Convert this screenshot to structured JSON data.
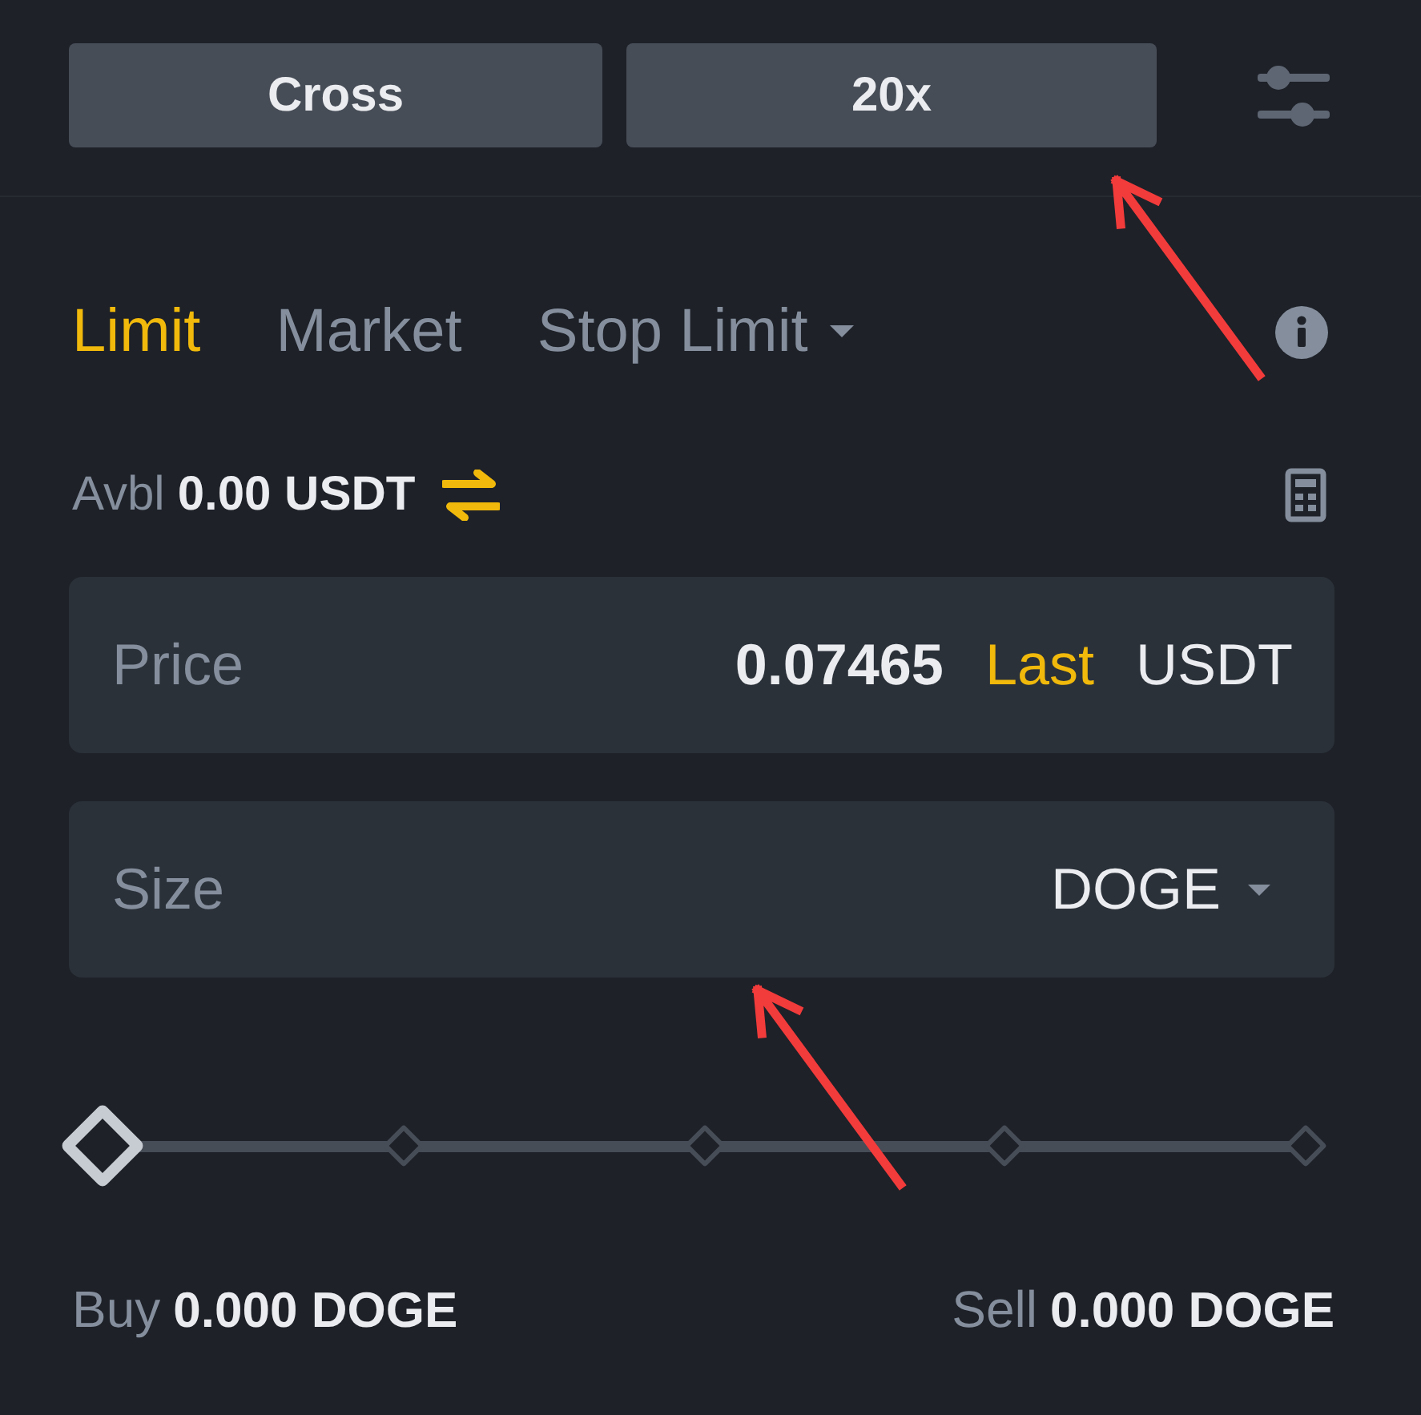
{
  "margin_mode_button": {
    "label": "Cross"
  },
  "leverage_button": {
    "label": "20x"
  },
  "order_types": [
    {
      "label": "Limit",
      "selected": true,
      "kind": "tab"
    },
    {
      "label": "Market",
      "selected": false,
      "kind": "tab"
    },
    {
      "label": "Stop Limit",
      "selected": false,
      "kind": "dropdown"
    }
  ],
  "available": {
    "label": "Avbl",
    "value": "0.00 USDT"
  },
  "price": {
    "label": "Price",
    "value": "0.07465",
    "last_button": "Last",
    "unit": "USDT"
  },
  "size": {
    "label": "Size",
    "unit": "DOGE"
  },
  "size_slider": {
    "level": 0
  },
  "max_orders": [
    {
      "label": "Buy",
      "value": "0.000 DOGE"
    },
    {
      "label": "Sell",
      "value": "0.000 DOGE"
    }
  ]
}
